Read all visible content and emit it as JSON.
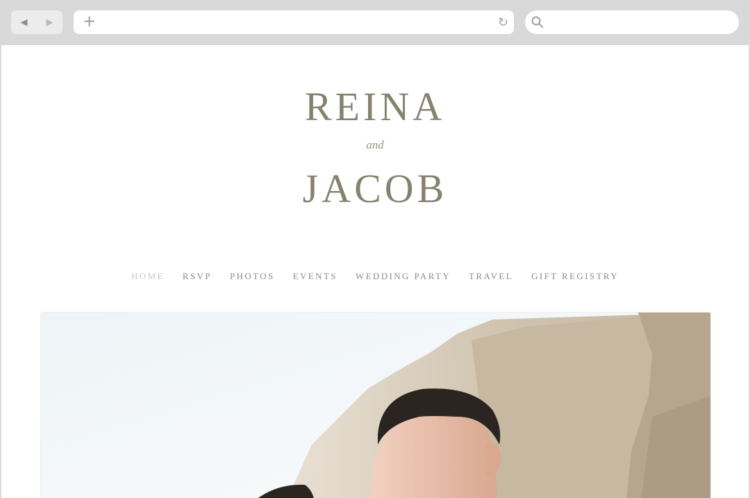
{
  "browser": {
    "back_icon": "back-arrow-icon",
    "forward_icon": "forward-arrow-icon",
    "new_tab_icon": "plus-icon",
    "reload_icon": "reload-icon",
    "search_icon": "search-icon"
  },
  "site": {
    "name_first": "REINA",
    "and": "and",
    "name_second": "JACOB",
    "colors": {
      "monogram": "#85836e",
      "nav_text": "#8c8c8c",
      "nav_active": "#c9c9c9"
    }
  },
  "nav": {
    "items": [
      {
        "label": "HOME",
        "active": true
      },
      {
        "label": "RSVP"
      },
      {
        "label": "PHOTOS"
      },
      {
        "label": "EVENTS"
      },
      {
        "label": "WEDDING PARTY"
      },
      {
        "label": "TRAVEL"
      },
      {
        "label": "GIFT REGISTRY"
      }
    ]
  }
}
